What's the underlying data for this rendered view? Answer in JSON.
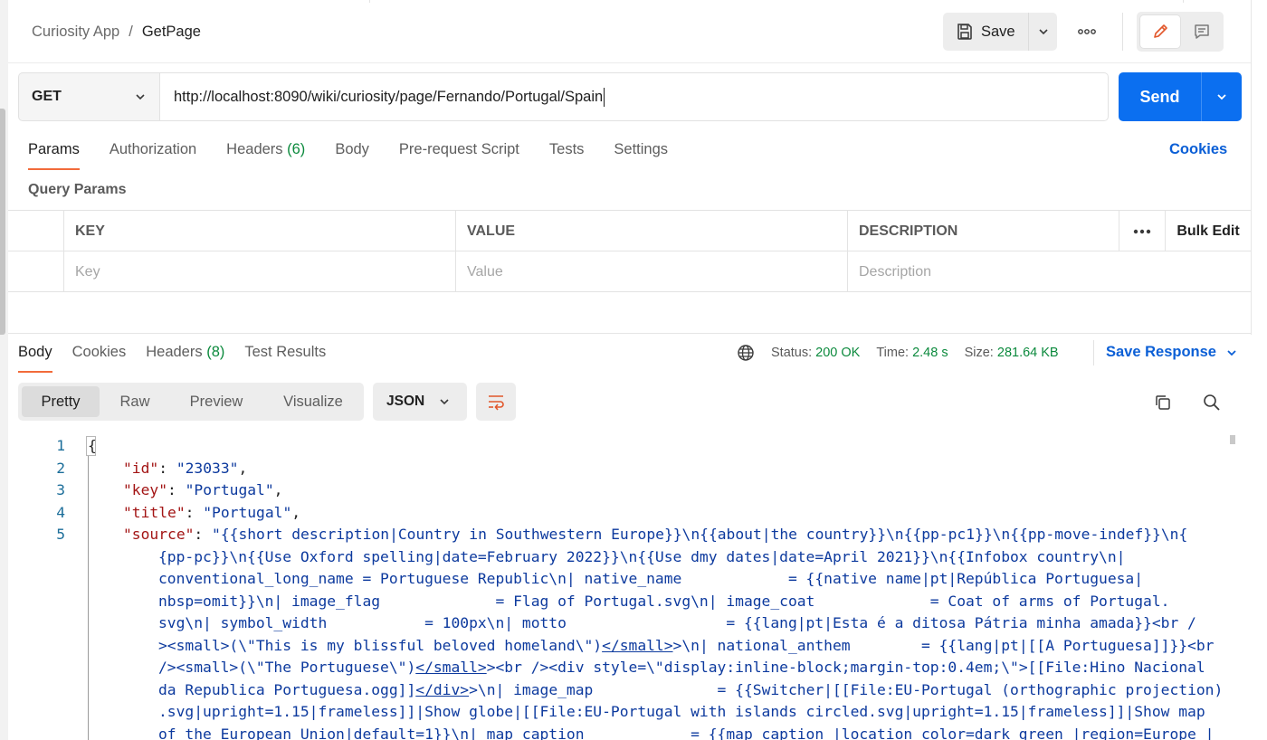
{
  "header": {
    "breadcrumb_parent": "Curiosity App",
    "breadcrumb_sep": "/",
    "breadcrumb_current": "GetPage",
    "save_label": "Save"
  },
  "request": {
    "method": "GET",
    "url": "http://localhost:8090/wiki/curiosity/page/Fernando/Portugal/Spain",
    "send_label": "Send",
    "tabs": [
      {
        "label": "Params",
        "count": ""
      },
      {
        "label": "Authorization",
        "count": ""
      },
      {
        "label": "Headers",
        "count": "(6)"
      },
      {
        "label": "Body",
        "count": ""
      },
      {
        "label": "Pre-request Script",
        "count": ""
      },
      {
        "label": "Tests",
        "count": ""
      },
      {
        "label": "Settings",
        "count": ""
      }
    ],
    "cookies_label": "Cookies",
    "query_params_title": "Query Params",
    "params_table": {
      "headers": [
        "KEY",
        "VALUE",
        "DESCRIPTION"
      ],
      "bulk_edit": "Bulk Edit",
      "placeholders": [
        "Key",
        "Value",
        "Description"
      ]
    }
  },
  "response": {
    "tabs": [
      {
        "label": "Body",
        "count": ""
      },
      {
        "label": "Cookies",
        "count": ""
      },
      {
        "label": "Headers",
        "count": "(8)"
      },
      {
        "label": "Test Results",
        "count": ""
      }
    ],
    "status_label": "Status:",
    "status_value": "200 OK",
    "time_label": "Time:",
    "time_value": "2.48 s",
    "size_label": "Size:",
    "size_value": "281.64 KB",
    "save_response_label": "Save Response",
    "view_modes": [
      "Pretty",
      "Raw",
      "Preview",
      "Visualize"
    ],
    "format": "JSON",
    "line_numbers": [
      "1",
      "2",
      "3",
      "4",
      "5"
    ],
    "body": {
      "open_brace": "{",
      "id_key": "\"id\"",
      "id_value": "\"23033\"",
      "key_key": "\"key\"",
      "key_value": "\"Portugal\"",
      "title_key": "\"title\"",
      "title_value": "\"Portugal\"",
      "source_key": "\"source\"",
      "source_lines": [
        "\"{{short description|Country in Southwestern Europe}}\\n{{about|the country}}\\n{{pp-pc1}}\\n{{pp-move-indef}}\\n{",
        "{pp-pc}}\\n{{Use Oxford spelling|date=February 2022}}\\n{{Use dmy dates|date=April 2021}}\\n{{Infobox country\\n|",
        "conventional_long_name = Portuguese Republic\\n| native_name            = {{native name|pt|República Portuguesa|",
        "nbsp=omit}}\\n| image_flag             = Flag of Portugal.svg\\n| image_coat             = Coat of arms of Portugal.",
        "svg\\n| symbol_width           = 100px\\n| motto                  = {{lang|pt|Esta é a ditosa Pátria minha amada}}<br /",
        "><small>(\\\"This is my blissful beloved homeland\\\")",
        "/><small>(\\\"The Portuguese\\\")",
        "da Republica Portuguesa.ogg]]",
        ".svg|upright=1.15|frameless]]|Show globe|[[File:EU-Portugal with islands circled.svg|upright=1.15|frameless]]|Show map",
        "of the European Union|default=1}}\\n| map_caption            = {{map caption |location_color=dark green |region=Europe |"
      ],
      "line6_close_tag": "</small>",
      "line6_tail": ">\\n| national_anthem        = {{lang|pt|[[A Portuguesa]]}}<br",
      "line7_close_tag": "</small>",
      "line7_tail": "><br /><div style=\\\"display:inline-block;margin-top:0.4em;\\\">[[File:Hino Nacional",
      "line8_close_tag": "</div>",
      "line8_tail": ">\\n| image_map              = {{Switcher|[[File:EU-Portugal (orthographic projection)"
    }
  },
  "colors": {
    "accent_orange": "#f26b3a",
    "send_blue": "#0b6ff0",
    "link_blue": "#0b5fd6",
    "success_green": "#0c8a3d",
    "json_key_red": "#a31515",
    "json_string_blue": "#0d3a9e"
  },
  "icons": {
    "save": "floppy-disk-icon",
    "more": "ellipsis-icon",
    "edit": "pencil-icon",
    "comment": "comment-icon",
    "globe": "globe-icon",
    "wrap": "wrap-lines-icon",
    "copy": "copy-icon",
    "search": "search-icon"
  }
}
